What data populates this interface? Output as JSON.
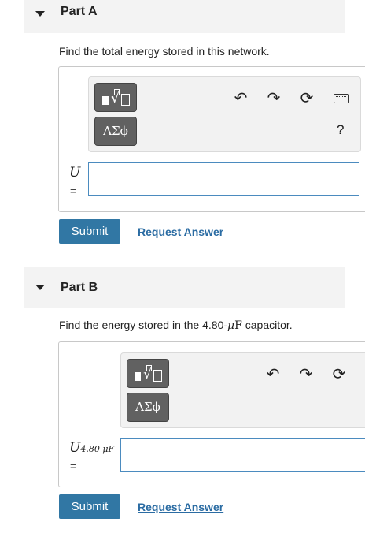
{
  "partA": {
    "title": "Part A",
    "question": "Find the total energy stored in this network.",
    "toolbar": {
      "greek_label": "ΑΣϕ",
      "undo_glyph": "↶",
      "redo_glyph": "↷",
      "reset_glyph": "⟳",
      "help_label": "?"
    },
    "variable": "U",
    "equals": "=",
    "answer_value": "",
    "submit_label": "Submit",
    "request_label": "Request Answer"
  },
  "partB": {
    "title": "Part B",
    "question_prefix": "Find the energy stored in the 4.80-",
    "question_mu": "μ",
    "question_unit": "F",
    "question_suffix": " capacitor.",
    "toolbar": {
      "greek_label": "ΑΣϕ",
      "undo_glyph": "↶",
      "redo_glyph": "↷",
      "reset_glyph": "⟳"
    },
    "variable": "U",
    "variable_sub": "4.80 μF",
    "equals": "=",
    "answer_value": "",
    "submit_label": "Submit",
    "request_label": "Request Answer"
  },
  "icons": [
    "collapse-caret-icon",
    "template-icon",
    "undo-icon",
    "redo-icon",
    "reset-icon",
    "keyboard-icon",
    "help-icon"
  ],
  "colors": {
    "submit_bg": "#3177a4",
    "link": "#2b6ca3",
    "input_border": "#4b8bbf",
    "header_bg": "#f3f3f3"
  }
}
